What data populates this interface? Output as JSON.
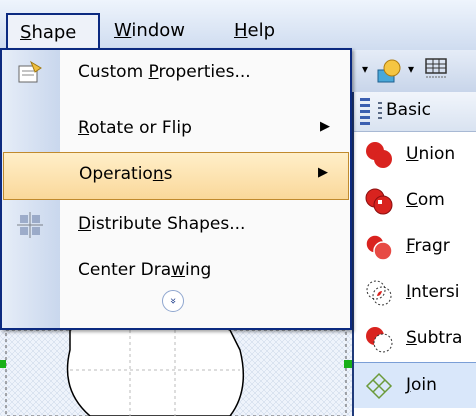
{
  "menubar": {
    "items": [
      {
        "label": "Shape",
        "accel": "S",
        "rest": "hape"
      },
      {
        "label": "Window",
        "accel": "W",
        "rest": "indow"
      },
      {
        "label": "Help",
        "accel": "H",
        "rest": "elp"
      }
    ]
  },
  "toolbar": {
    "arrow": "▾"
  },
  "shape_menu": {
    "items": [
      {
        "pre": "Custom ",
        "accel": "P",
        "post": "roperties...",
        "submenu": false,
        "enabled": true
      },
      {
        "pre": "",
        "accel": "R",
        "post": "otate or Flip",
        "submenu": true,
        "enabled": true
      },
      {
        "pre": "Operatio",
        "accel": "n",
        "post": "s",
        "submenu": true,
        "enabled": true,
        "highlighted": true
      },
      {
        "pre": "",
        "accel": "D",
        "post": "istribute Shapes...",
        "submenu": false,
        "enabled": false
      },
      {
        "pre": "Center Dra",
        "accel": "w",
        "post": "ing",
        "submenu": false,
        "enabled": true
      }
    ],
    "submenu_arrow": "▶",
    "expand_glyph": "»"
  },
  "shapes_panel": {
    "stencil_label": "Basic",
    "operations": [
      {
        "accel": "U",
        "post": "nion"
      },
      {
        "accel": "C",
        "post": "om"
      },
      {
        "accel": "F",
        "post": "ragr"
      },
      {
        "accel": "I",
        "post": "ntersi"
      },
      {
        "accel": "S",
        "post": "ubtra"
      },
      {
        "accel": "J",
        "post": "oin"
      }
    ]
  },
  "colors": {
    "accent_border": "#0c2a80",
    "highlight_top": "#ffefc9",
    "highlight_bottom": "#fad89a",
    "op_red": "#d9231f"
  }
}
